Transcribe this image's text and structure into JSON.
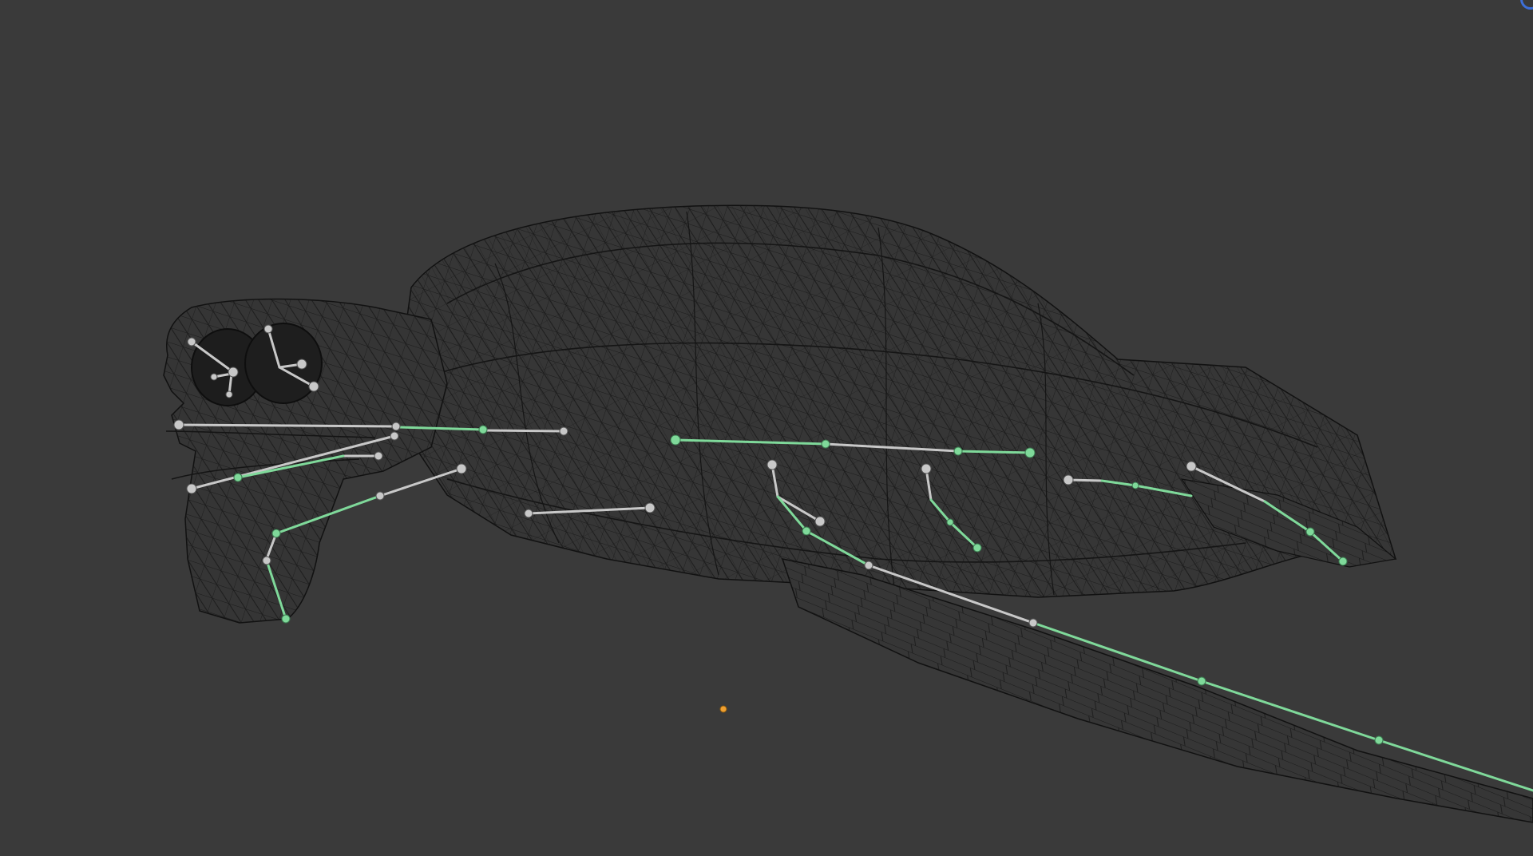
{
  "viewport": {
    "name": "3d-viewport",
    "mode": "wireframe"
  },
  "colors": {
    "background": "#3a3a3a",
    "wireframe": "#121212",
    "bone_default": "#c8c8c8",
    "bone_selected": "#7fd99a",
    "origin": "#f0a030",
    "gizmo": "#3d6fd8"
  },
  "objects": [
    {
      "name": "turtle-mesh",
      "type": "mesh",
      "display": "wireframe"
    },
    {
      "name": "turtle-armature",
      "type": "armature",
      "display": "stick"
    }
  ]
}
